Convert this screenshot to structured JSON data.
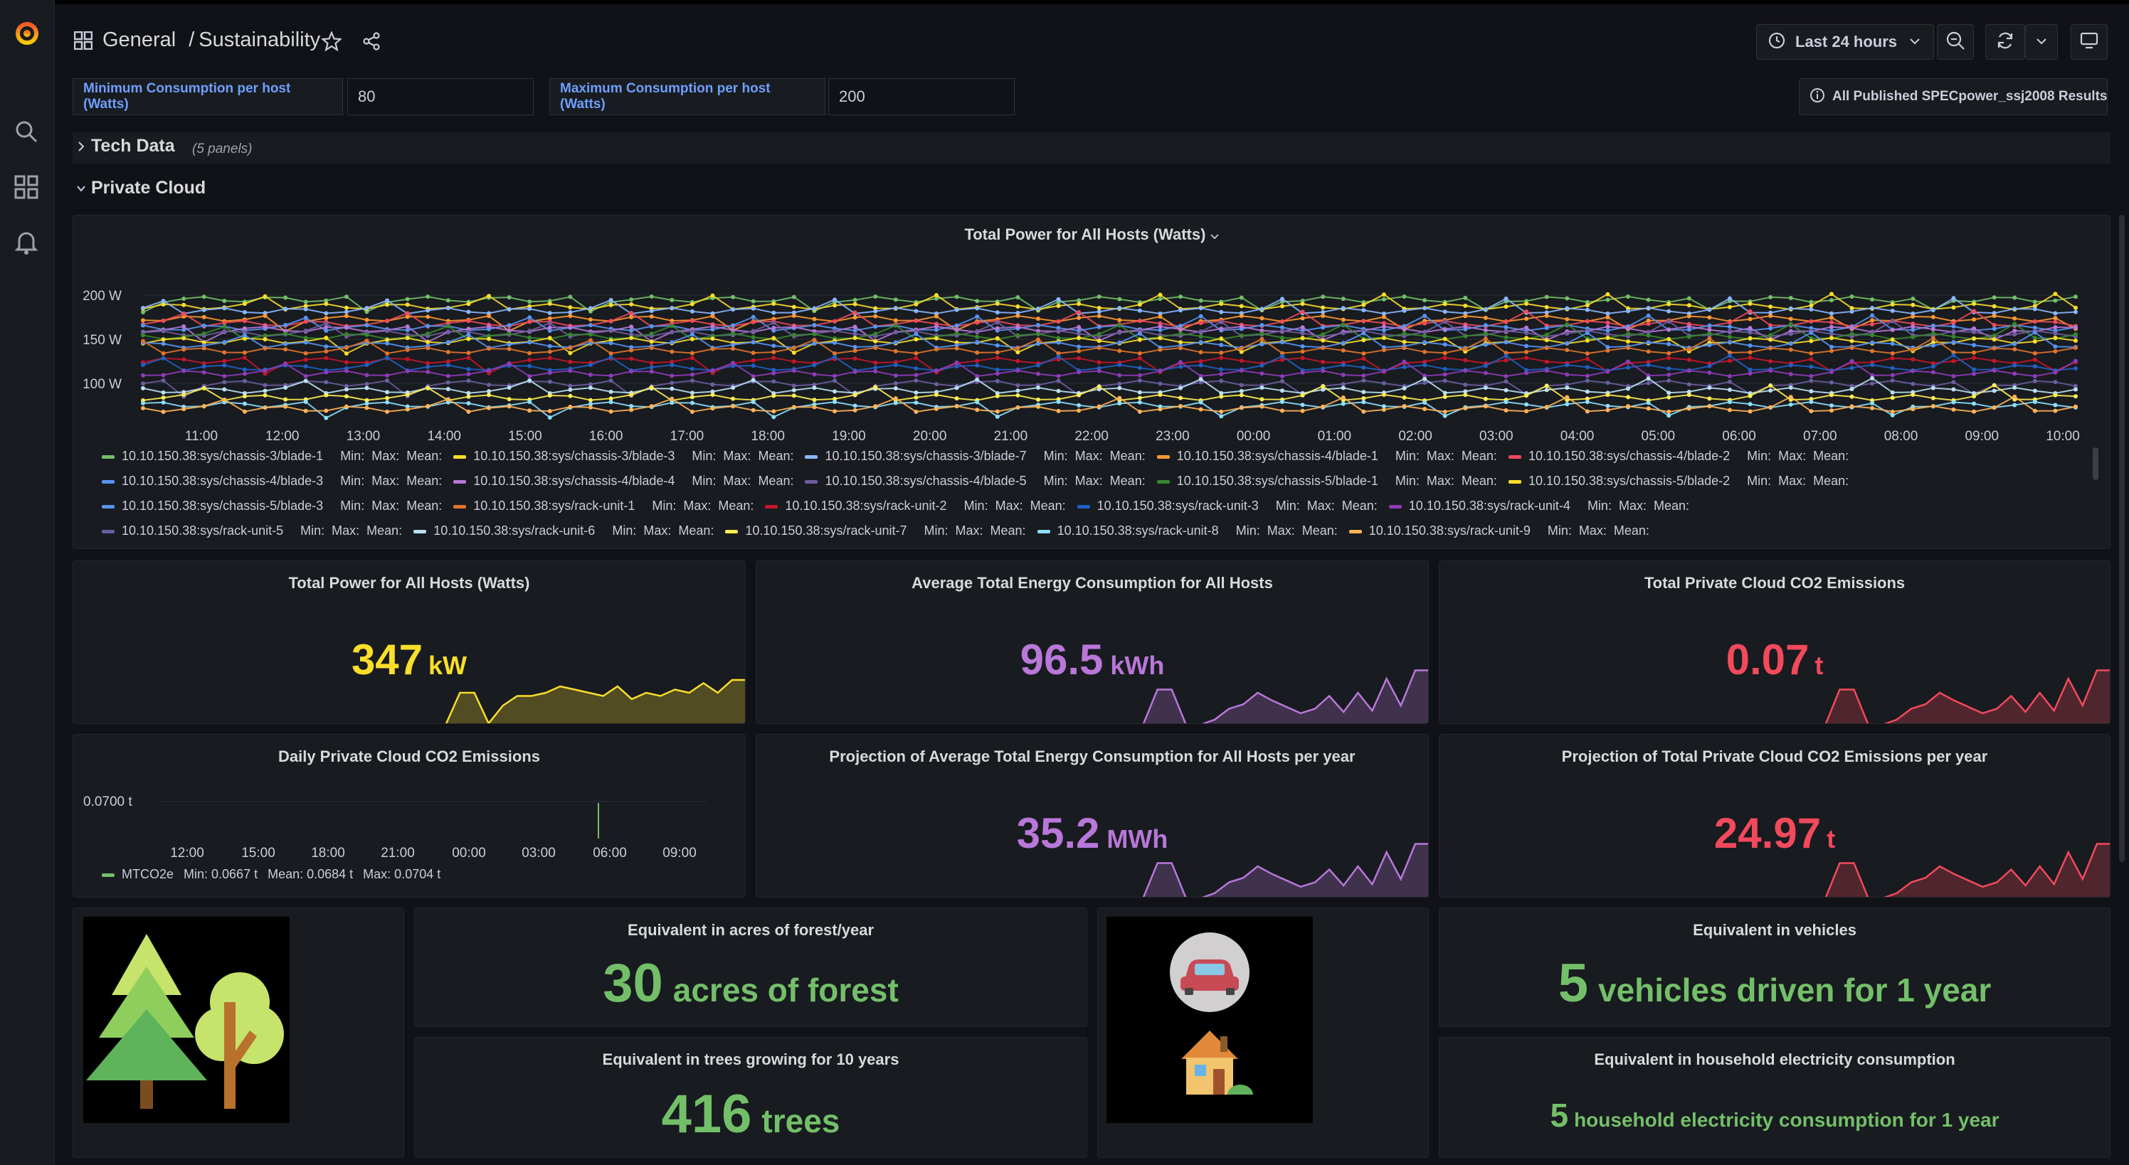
{
  "breadcrumb": {
    "folder": "General",
    "separator": "/",
    "dashboard": "Sustainability"
  },
  "time_picker": {
    "label": "Last 24 hours"
  },
  "variables": [
    {
      "label": "Minimum Consumption per host (Watts)",
      "value": "80"
    },
    {
      "label": "Maximum Consumption per host (Watts)",
      "value": "200"
    }
  ],
  "link_button": {
    "label": "All Published SPECpower_ssj2008 Results"
  },
  "rows": [
    {
      "title": "Tech Data",
      "note": "(5 panels)",
      "collapsed": true
    },
    {
      "title": "Private Cloud",
      "collapsed": false
    }
  ],
  "colors": {
    "bg": "#111217",
    "panel": "#181b1f",
    "yellow": "#fade2a",
    "purple": "#b877d9",
    "red": "#f2495c",
    "green": "#73bf69",
    "blue": "#6e9fff"
  },
  "main_chart": {
    "title": "Total Power for All Hosts (Watts)",
    "y_ticks": [
      "200 W",
      "150 W",
      "100 W"
    ],
    "x_ticks": [
      "11:00",
      "12:00",
      "13:00",
      "14:00",
      "15:00",
      "16:00",
      "17:00",
      "18:00",
      "19:00",
      "20:00",
      "21:00",
      "22:00",
      "23:00",
      "00:00",
      "01:00",
      "02:00",
      "03:00",
      "04:00",
      "05:00",
      "06:00",
      "07:00",
      "08:00",
      "09:00",
      "10:00"
    ],
    "legend": [
      {
        "name": "10.10.150.38:sys/chassis-3/blade-1",
        "color": "#73bf69"
      },
      {
        "name": "10.10.150.38:sys/chassis-3/blade-3",
        "color": "#fade2a"
      },
      {
        "name": "10.10.150.38:sys/chassis-3/blade-7",
        "color": "#8ab8ff"
      },
      {
        "name": "10.10.150.38:sys/chassis-4/blade-1",
        "color": "#ff9830"
      },
      {
        "name": "10.10.150.38:sys/chassis-4/blade-2",
        "color": "#f2495c"
      },
      {
        "name": "10.10.150.38:sys/chassis-4/blade-3",
        "color": "#5794f2"
      },
      {
        "name": "10.10.150.38:sys/chassis-4/blade-4",
        "color": "#b877d9"
      },
      {
        "name": "10.10.150.38:sys/chassis-4/blade-5",
        "color": "#705da0"
      },
      {
        "name": "10.10.150.38:sys/chassis-5/blade-1",
        "color": "#37872d"
      },
      {
        "name": "10.10.150.38:sys/chassis-5/blade-2",
        "color": "#fade2a"
      },
      {
        "name": "10.10.150.38:sys/chassis-5/blade-3",
        "color": "#5794f2"
      },
      {
        "name": "10.10.150.38:sys/rack-unit-1",
        "color": "#e0752d"
      },
      {
        "name": "10.10.150.38:sys/rack-unit-2",
        "color": "#c4162a"
      },
      {
        "name": "10.10.150.38:sys/rack-unit-3",
        "color": "#1f60c4"
      },
      {
        "name": "10.10.150.38:sys/rack-unit-4",
        "color": "#8f3bb8"
      },
      {
        "name": "10.10.150.38:sys/rack-unit-5",
        "color": "#6a5da0"
      },
      {
        "name": "10.10.150.38:sys/rack-unit-6",
        "color": "#badff4"
      },
      {
        "name": "10.10.150.38:sys/rack-unit-7",
        "color": "#ffee52"
      },
      {
        "name": "10.10.150.38:sys/rack-unit-8",
        "color": "#8ae0ff"
      },
      {
        "name": "10.10.150.38:sys/rack-unit-9",
        "color": "#ffb357"
      }
    ],
    "legend_min": "Min:",
    "legend_max": "Max:",
    "legend_mean": "Mean:"
  },
  "stats": [
    {
      "title": "Total Power for All Hosts (Watts)",
      "value": "347",
      "unit": "kW",
      "color": "#fade2a"
    },
    {
      "title": "Average Total Energy Consumption for All Hosts",
      "value": "96.5",
      "unit": "kWh",
      "color": "#b877d9"
    },
    {
      "title": "Total Private Cloud CO2 Emissions",
      "value": "0.07",
      "unit": "t",
      "color": "#f2495c"
    },
    {
      "title": "Projection of Average Total Energy Consumption for All Hosts per year",
      "value": "35.2",
      "unit": "MWh",
      "color": "#b877d9"
    },
    {
      "title": "Projection of Total Private Cloud CO2 Emissions per year",
      "value": "24.97",
      "unit": "t",
      "color": "#f2495c"
    }
  ],
  "daily_chart": {
    "title": "Daily Private Cloud CO2 Emissions",
    "y_tick": "0.0700 t",
    "x_ticks": [
      "12:00",
      "15:00",
      "18:00",
      "21:00",
      "00:00",
      "03:00",
      "06:00",
      "09:00"
    ],
    "legend": {
      "name": "MTCO2e",
      "min": "Min: 0.0667 t",
      "mean": "Mean: 0.0684 t",
      "max": "Max: 0.0704 t",
      "color": "#73bf69"
    }
  },
  "equivalents": [
    {
      "title": "Equivalent in acres of forest/year",
      "value": "30",
      "unit": "acres of forest"
    },
    {
      "title": "Equivalent in trees growing for 10 years",
      "value": "416",
      "unit": "trees"
    },
    {
      "title": "Equivalent in vehicles",
      "value": "5",
      "unit": "vehicles driven for 1 year"
    },
    {
      "title": "Equivalent in household electricity consumption",
      "value": "5",
      "unit": "household electricity consumption for 1 year"
    }
  ]
}
